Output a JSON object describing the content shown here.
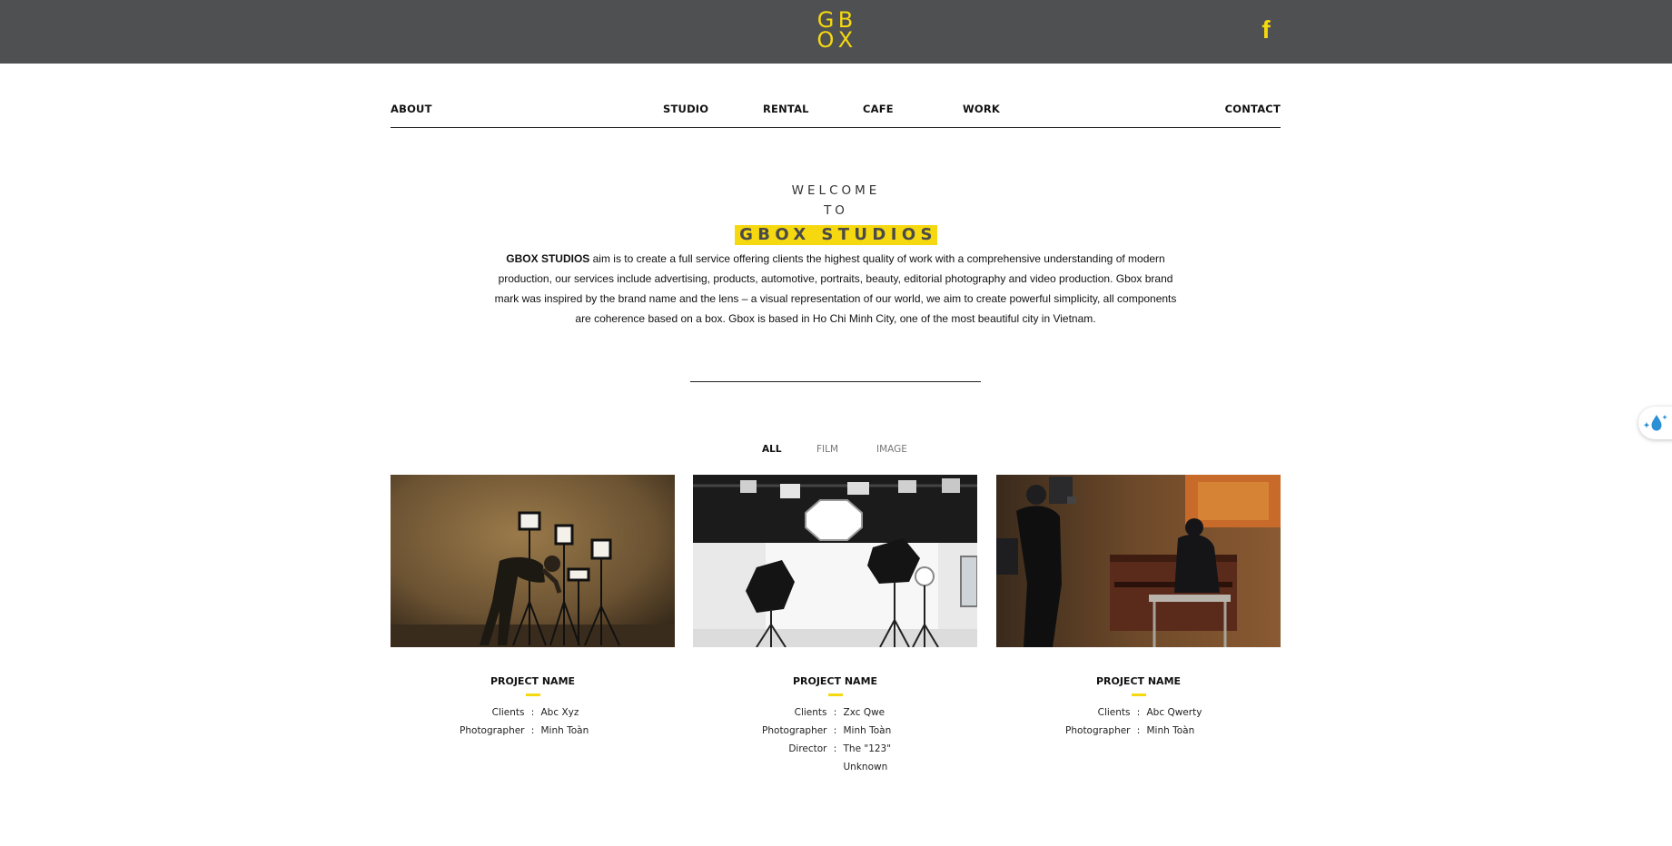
{
  "header": {
    "logo_letters": [
      "G",
      "B",
      "O",
      "X"
    ],
    "facebook_glyph": "f",
    "colors": {
      "bar": "#4f5052",
      "accent": "#f5d80f"
    }
  },
  "nav": {
    "items": [
      "ABOUT",
      "STUDIO",
      "RENTAL",
      "CAFE",
      "WORK",
      "CONTACT"
    ]
  },
  "hero": {
    "line1": "WELCOME",
    "line2": "TO",
    "brand": "GBOX STUDIOS",
    "intro_lead": "GBOX STUDIOS",
    "intro_rest": " aim is to create a full service offering clients the highest quality of work with a comprehensive understanding of modern production, our services include advertising, products, automotive, portraits, beauty, editorial photography and video production. Gbox brand mark was inspired by the brand name and the lens – a visual representation of our world, we aim to create powerful simplicity, all components are coherence based on a box. Gbox is based in Ho Chi Minh City, one of the most beautiful city in Vietnam."
  },
  "filters": {
    "items": [
      "ALL",
      "FILM",
      "IMAGE"
    ],
    "active": "ALL"
  },
  "projects": [
    {
      "title": "PROJECT NAME",
      "meta": [
        {
          "label": "Clients",
          "sep": ":",
          "value": "Abc Xyz"
        },
        {
          "label": "Photographer",
          "sep": ":",
          "value": "Minh Toàn"
        }
      ]
    },
    {
      "title": "PROJECT NAME",
      "meta": [
        {
          "label": "Clients",
          "sep": ":",
          "value": "Zxc Qwe"
        },
        {
          "label": "Photographer",
          "sep": ":",
          "value": "Minh Toàn"
        },
        {
          "label": "Director",
          "sep": ":",
          "value": "The \"123\" Unknown"
        }
      ]
    },
    {
      "title": "PROJECT NAME",
      "meta": [
        {
          "label": "Clients",
          "sep": ":",
          "value": "Abc Qwerty"
        },
        {
          "label": "Photographer",
          "sep": ":",
          "value": "Minh Toàn"
        }
      ]
    }
  ]
}
